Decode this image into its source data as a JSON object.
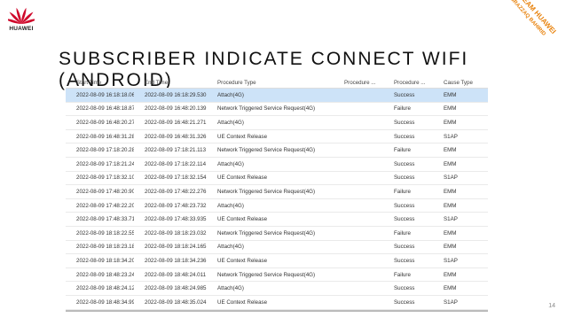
{
  "logo": {
    "text": "HUAWEI"
  },
  "title": "SUBSCRIBER INDICATE CONNECT WIFI (ANDROID)",
  "stamp": {
    "line1": "VIP TEAM HUAWEI",
    "line2": "ABRAZZAQ BAHIRID"
  },
  "columns": [
    "Start Time",
    "End Time",
    "Procedure Type",
    "Procedure ...",
    "Procedure ...",
    "Cause Type"
  ],
  "rows": [
    [
      "2022-08-09 16:18:18.066",
      "2022-08-09 16:18:29.530",
      "Attach(4G)",
      "",
      "Success",
      "EMM"
    ],
    [
      "2022-08-09 16:48:18.874",
      "2022-08-09 16:48:20.139",
      "Network Triggered Service Request(4G)",
      "",
      "Failure",
      "EMM"
    ],
    [
      "2022-08-09 16:48:20.278",
      "2022-08-09 16:48:21.271",
      "Attach(4G)",
      "",
      "Success",
      "EMM"
    ],
    [
      "2022-08-09 16:48:31.289",
      "2022-08-09 16:48:31.326",
      "UE Context Release",
      "",
      "Success",
      "S1AP"
    ],
    [
      "2022-08-09 17:18:20.280",
      "2022-08-09 17:18:21.113",
      "Network Triggered Service Request(4G)",
      "",
      "Failure",
      "EMM"
    ],
    [
      "2022-08-09 17:18:21.248",
      "2022-08-09 17:18:22.114",
      "Attach(4G)",
      "",
      "Success",
      "EMM"
    ],
    [
      "2022-08-09 17:18:32.107",
      "2022-08-09 17:18:32.154",
      "UE Context Release",
      "",
      "Success",
      "S1AP"
    ],
    [
      "2022-08-09 17:48:20.909",
      "2022-08-09 17:48:22.276",
      "Network Triggered Service Request(4G)",
      "",
      "Failure",
      "EMM"
    ],
    [
      "2022-08-09 17:48:22.200",
      "2022-08-09 17:48:23.732",
      "Attach(4G)",
      "",
      "Success",
      "EMM"
    ],
    [
      "2022-08-09 17:48:33.715",
      "2022-08-09 17:48:33.935",
      "UE Context Release",
      "",
      "Success",
      "S1AP"
    ],
    [
      "2022-08-09 18:18:22.556",
      "2022-08-09 18:18:23.032",
      "Network Triggered Service Request(4G)",
      "",
      "Failure",
      "EMM"
    ],
    [
      "2022-08-09 18:18:23.183",
      "2022-08-09 18:18:24.165",
      "Attach(4G)",
      "",
      "Success",
      "EMM"
    ],
    [
      "2022-08-09 18:18:34.201",
      "2022-08-09 18:18:34.236",
      "UE Context Release",
      "",
      "Success",
      "S1AP"
    ],
    [
      "2022-08-09 18:48:23.247",
      "2022-08-09 18:48:24.011",
      "Network Triggered Service Request(4G)",
      "",
      "Failure",
      "EMM"
    ],
    [
      "2022-08-09 18:48:24.128",
      "2022-08-09 18:48:24.985",
      "Attach(4G)",
      "",
      "Success",
      "EMM"
    ],
    [
      "2022-08-09 18:48:34.995",
      "2022-08-09 18:48:35.024",
      "UE Context Release",
      "",
      "Success",
      "S1AP"
    ]
  ],
  "selected_row": 0,
  "page_number": "14"
}
